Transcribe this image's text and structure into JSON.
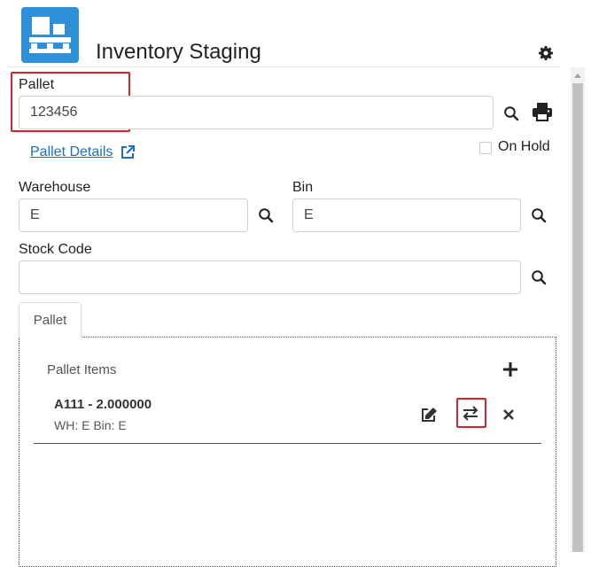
{
  "app": {
    "title": "Inventory Staging",
    "logo_icon": "pallet-boxes-icon",
    "settings_icon": "gear-icon",
    "accent_color": "#2f8fd8",
    "highlight_color": "#d9222a"
  },
  "pallet": {
    "label": "Pallet",
    "value": "123456",
    "search_icon": "search-icon",
    "print_icon": "print-icon",
    "details_link": "Pallet Details",
    "details_icon": "external-link-icon",
    "on_hold_label": "On Hold",
    "on_hold_checked": false
  },
  "warehouse": {
    "label": "Warehouse",
    "value": "E",
    "search_icon": "search-icon"
  },
  "bin": {
    "label": "Bin",
    "value": "E",
    "search_icon": "search-icon"
  },
  "stock_code": {
    "label": "Stock Code",
    "value": "",
    "search_icon": "search-icon"
  },
  "tabs": [
    {
      "label": "Pallet",
      "active": true
    }
  ],
  "pallet_items": {
    "title": "Pallet Items",
    "add_icon": "plus-icon",
    "items": [
      {
        "code_line": "A111 - 2.000000",
        "location_line": "WH: E Bin: E",
        "edit_icon": "edit-icon",
        "transfer_icon": "transfer-arrows-icon",
        "remove_icon": "close-icon"
      }
    ]
  }
}
